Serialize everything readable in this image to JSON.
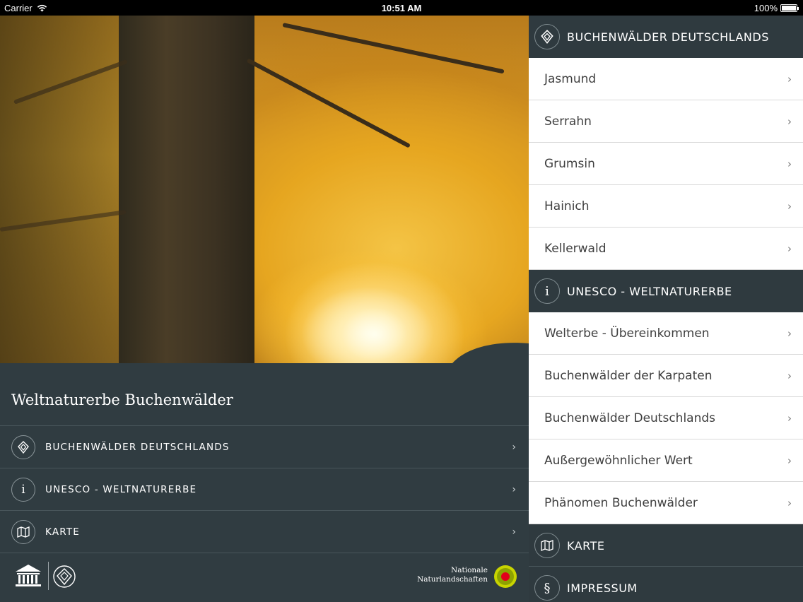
{
  "status_bar": {
    "carrier": "Carrier",
    "time": "10:51 AM",
    "battery": "100%"
  },
  "left_panel": {
    "title": "Weltnaturerbe Buchenwälder",
    "menu": [
      {
        "label": "BUCHENWÄLDER DEUTSCHLANDS",
        "icon": "forest-leaf-icon"
      },
      {
        "label": "UNESCO - WELTNATURERBE",
        "icon": "info-icon",
        "glyph": "i"
      },
      {
        "label": "KARTE",
        "icon": "map-icon"
      }
    ],
    "footer": {
      "partner_line1": "Nationale",
      "partner_line2": "Naturlandschaften"
    }
  },
  "right_panel": {
    "sections": [
      {
        "title": "BUCHENWÄLDER DEUTSCHLANDS",
        "icon": "forest-leaf-icon",
        "items": [
          "Jasmund",
          "Serrahn",
          "Grumsin",
          "Hainich",
          "Kellerwald"
        ]
      },
      {
        "title": "UNESCO - WELTNATURERBE",
        "icon": "info-icon",
        "glyph": "i",
        "items": [
          "Welterbe - Übereinkommen",
          "Buchenwälder der Karpaten",
          "Buchenwälder Deutschlands",
          "Außergewöhnlicher Wert",
          "Phänomen Buchenwälder"
        ]
      },
      {
        "title": "KARTE",
        "icon": "map-icon",
        "items": []
      },
      {
        "title": "IMPRESSUM",
        "icon": "paragraph-icon",
        "glyph": "§",
        "items": []
      }
    ]
  },
  "colors": {
    "panel_dark": "#2f3a3f",
    "item_bg": "#ffffff",
    "item_text": "#3f3f3f",
    "partner_logo_ring": "#c8d400",
    "partner_logo_dot": "#e2001a"
  }
}
